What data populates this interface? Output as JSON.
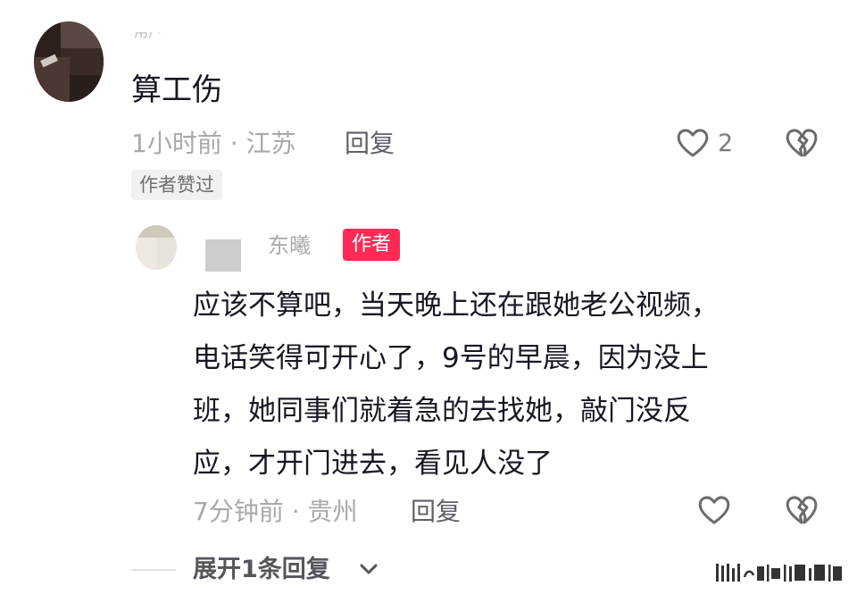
{
  "comments": [
    {
      "username": "用户",
      "text": "算工伤",
      "meta": "1小时前 · 江苏",
      "reply_label": "回复",
      "like_count": "2",
      "badge": "作者赞过"
    }
  ],
  "reply": {
    "username": "东曦",
    "author_badge": "作者",
    "text_lines": [
      "应该不算吧，当天晚上还在跟她老公视频，",
      "电话笑得可开心了，9号的早晨，因为没上",
      "班，她同事们就着急的去找她，敲门没反",
      "应，才开门进去，看见人没了"
    ],
    "meta": "7分钟前 · 贵州",
    "reply_label": "回复"
  },
  "expand": {
    "label": "展开1条回复"
  },
  "icons": {
    "like": "heart-outline-icon",
    "dislike": "broken-heart-icon",
    "expand": "chevron-down-icon"
  },
  "colors": {
    "author_badge_bg": "#fe2c55",
    "text_primary": "#161823",
    "text_secondary": "#a8a8ad",
    "badge_bg": "#f1f1f2"
  }
}
